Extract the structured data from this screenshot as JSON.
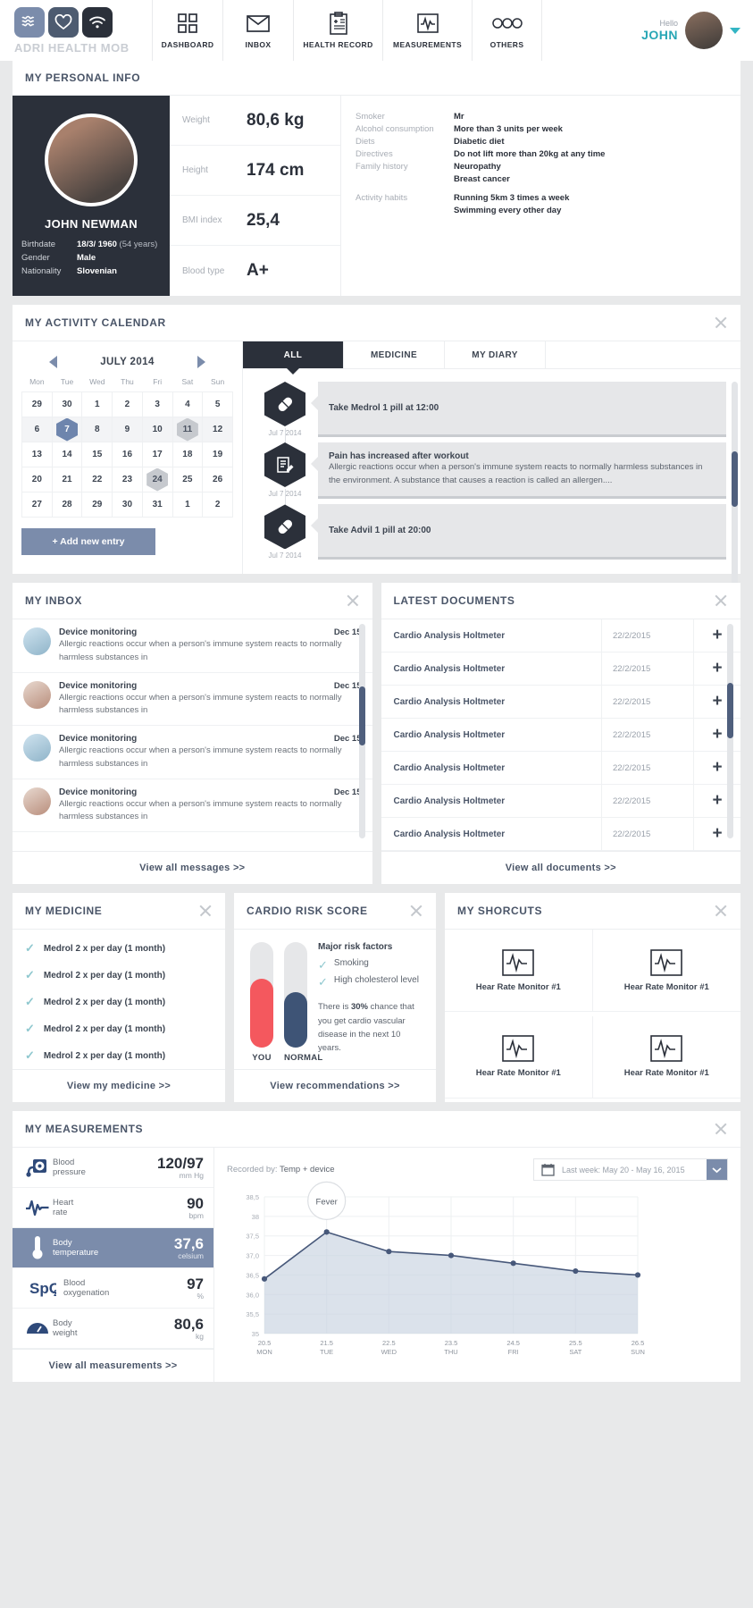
{
  "header": {
    "logo_text": "ADRI HEALTH MOB",
    "nav": [
      {
        "label": "DASHBOARD",
        "icon": "grid-icon"
      },
      {
        "label": "INBOX",
        "icon": "envelope-icon"
      },
      {
        "label": "HEALTH RECORD",
        "icon": "clipboard-icon"
      },
      {
        "label": "MEASUREMENTS",
        "icon": "pulse-icon"
      },
      {
        "label": "OTHERS",
        "icon": "dots-icon"
      }
    ],
    "hello": "Hello",
    "username": "JOHN"
  },
  "personal": {
    "title": "MY PERSONAL INFO",
    "name": "JOHN NEWMAN",
    "rows": [
      {
        "key": "Birthdate",
        "value": "18/3/ 1960",
        "extra": "(54 years)"
      },
      {
        "key": "Gender",
        "value": "Male",
        "extra": ""
      },
      {
        "key": "Nationality",
        "value": "Slovenian",
        "extra": ""
      }
    ],
    "vitals": [
      {
        "key": "Weight",
        "value": "80,6 kg"
      },
      {
        "key": "Height",
        "value": "174 cm"
      },
      {
        "key": "BMI index",
        "value": "25,4"
      },
      {
        "key": "Blood type",
        "value": "A+"
      }
    ],
    "habits": [
      {
        "key": "Smoker",
        "value": "Mr"
      },
      {
        "key": "Alcohol consumption",
        "value": "More than 3 units per week"
      },
      {
        "key": "Diets",
        "value": "Diabetic diet"
      },
      {
        "key": "Directives",
        "value": "Do not lift more than 20kg at any time"
      },
      {
        "key": "Family history",
        "value": "Neuropathy"
      },
      {
        "key": "",
        "value": "Breast cancer"
      },
      {
        "key": "Activity habits",
        "value": "Running 5km 3 times a week"
      },
      {
        "key": "",
        "value": "Swimming every other day"
      }
    ]
  },
  "calendar": {
    "title": "MY ACTIVITY CALENDAR",
    "month": "JULY 2014",
    "daynames": [
      "Mon",
      "Tue",
      "Wed",
      "Thu",
      "Fri",
      "Sat",
      "Sun"
    ],
    "weeks": [
      [
        {
          "d": "29",
          "m": true
        },
        {
          "d": "30",
          "m": true
        },
        {
          "d": "1"
        },
        {
          "d": "2"
        },
        {
          "d": "3"
        },
        {
          "d": "4"
        },
        {
          "d": "5"
        }
      ],
      [
        {
          "d": "6"
        },
        {
          "d": "7",
          "hex": "sel"
        },
        {
          "d": "8"
        },
        {
          "d": "9"
        },
        {
          "d": "10"
        },
        {
          "d": "11",
          "hex": "gray"
        },
        {
          "d": "12"
        }
      ],
      [
        {
          "d": "13"
        },
        {
          "d": "14"
        },
        {
          "d": "15"
        },
        {
          "d": "16"
        },
        {
          "d": "17"
        },
        {
          "d": "18"
        },
        {
          "d": "19"
        }
      ],
      [
        {
          "d": "20"
        },
        {
          "d": "21"
        },
        {
          "d": "22"
        },
        {
          "d": "23"
        },
        {
          "d": "24",
          "hex": "gray"
        },
        {
          "d": "25"
        },
        {
          "d": "26"
        }
      ],
      [
        {
          "d": "27"
        },
        {
          "d": "28"
        },
        {
          "d": "29"
        },
        {
          "d": "30"
        },
        {
          "d": "31"
        },
        {
          "d": "1",
          "m": true
        },
        {
          "d": "2",
          "m": true
        }
      ]
    ],
    "shaded_week": 1,
    "add_entry": "+ Add new entry",
    "tabs": [
      {
        "label": "ALL",
        "active": true
      },
      {
        "label": "MEDICINE",
        "active": false
      },
      {
        "label": "MY DIARY",
        "active": false
      }
    ],
    "timeline": [
      {
        "icon": "pill-icon",
        "date": "Jul 7 2014",
        "title": "Take Medrol 1 pill at 12:00",
        "text": ""
      },
      {
        "icon": "diary-icon",
        "date": "Jul 7 2014",
        "title": "Pain has increased after workout",
        "text": "Allergic reactions occur when a person's immune system reacts to normally harmless substances in the environment. A substance that causes a reaction is called an allergen...."
      },
      {
        "icon": "pill-icon",
        "date": "Jul 7 2014",
        "title": "Take Advil 1 pill at 20:00",
        "text": ""
      }
    ]
  },
  "inbox": {
    "title": "MY INBOX",
    "messages": [
      {
        "from": "Device monitoring",
        "date": "Dec 15",
        "avatar": "avatar-male",
        "body": "Allergic reactions occur when a person's immune system reacts to normally harmless substances in"
      },
      {
        "from": "Device monitoring",
        "date": "Dec 15",
        "avatar": "avatar-female",
        "body": "Allergic reactions occur when a person's immune system reacts to normally harmless substances in"
      },
      {
        "from": "Device monitoring",
        "date": "Dec 15",
        "avatar": "avatar-male",
        "body": "Allergic reactions occur when a person's immune system reacts to normally harmless substances in"
      },
      {
        "from": "Device monitoring",
        "date": "Dec 15",
        "avatar": "avatar-female",
        "body": "Allergic reactions occur when a person's immune system reacts to normally harmless substances in"
      }
    ],
    "view_all": "View all messages >>"
  },
  "documents": {
    "title": "LATEST DOCUMENTS",
    "rows": [
      {
        "name": "Cardio Analysis Holtmeter",
        "date": "22/2/2015"
      },
      {
        "name": "Cardio Analysis Holtmeter",
        "date": "22/2/2015"
      },
      {
        "name": "Cardio Analysis Holtmeter",
        "date": "22/2/2015"
      },
      {
        "name": "Cardio Analysis Holtmeter",
        "date": "22/2/2015"
      },
      {
        "name": "Cardio Analysis Holtmeter",
        "date": "22/2/2015"
      },
      {
        "name": "Cardio Analysis Holtmeter",
        "date": "22/2/2015"
      },
      {
        "name": "Cardio Analysis Holtmeter",
        "date": "22/2/2015"
      }
    ],
    "add_icon": "plus-icon",
    "view_all": "View all documents >>"
  },
  "medicine": {
    "title": "MY MEDICINE",
    "items": [
      "Medrol 2 x per day (1 month)",
      "Medrol 2 x per day (1 month)",
      "Medrol 2 x per day (1 month)",
      "Medrol 2 x per day (1 month)",
      "Medrol 2 x per day (1 month)"
    ],
    "view_all": "View my medicine >>"
  },
  "cardio": {
    "title": "CARDIO RISK SCORE",
    "bars": [
      {
        "label": "YOU",
        "pct": 66,
        "color": "#f4585e"
      },
      {
        "label": "NORMAL",
        "pct": 53,
        "color": "#3e5476"
      }
    ],
    "risk_heading": "Major risk factors",
    "risk_factors": [
      "Smoking",
      "High cholesterol level"
    ],
    "summary_pre": "There is ",
    "summary_pct": "30%",
    "summary_post": " chance that you get cardio vascular disease in the next 10 years.",
    "view_all": "View recommendations >>"
  },
  "shortcuts": {
    "title": "MY SHORCUTS",
    "items": [
      {
        "label": "Hear Rate Monitor #1",
        "icon": "heart-rate-monitor-icon"
      },
      {
        "label": "Hear Rate Monitor #1",
        "icon": "heart-rate-monitor-icon"
      },
      {
        "label": "Hear Rate Monitor #1",
        "icon": "heart-rate-monitor-icon"
      },
      {
        "label": "Hear Rate Monitor #1",
        "icon": "heart-rate-monitor-icon"
      }
    ]
  },
  "measurements": {
    "title": "MY MEASUREMENTS",
    "rows": [
      {
        "name": "Blood\npressure",
        "name1": "Blood",
        "name2": "pressure",
        "value": "120/97",
        "unit": "mm Hg",
        "icon": "blood-pressure-icon",
        "active": false
      },
      {
        "name1": "Heart",
        "name2": "rate",
        "value": "90",
        "unit": "bpm",
        "icon": "heart-rate-icon",
        "active": false
      },
      {
        "name1": "Body",
        "name2": "temperature",
        "value": "37,6",
        "unit": "celsium",
        "icon": "thermometer-icon",
        "active": true
      },
      {
        "name1": "Blood",
        "name2": "oxygenation",
        "value": "97",
        "unit": "%",
        "icon": "spo2-icon",
        "active": false,
        "prefix": "SpO₂"
      },
      {
        "name1": "Body",
        "name2": "weight",
        "value": "80,6",
        "unit": "kg",
        "icon": "scale-icon",
        "active": false
      }
    ],
    "recorded_label": "Recorded by:",
    "recorded_value": "Temp + device",
    "date_range": "Last week: May 20 - May 16, 2015",
    "calendar_icon": "calendar-icon",
    "caret_icon": "chevron-down-icon",
    "view_all": "View all measurements >>"
  },
  "chart_data": {
    "type": "area",
    "title": "Body temperature",
    "xlabel": "",
    "ylabel": "celsium",
    "categories": [
      "20.5",
      "21.5",
      "22.5",
      "23.5",
      "24.5",
      "25.5",
      "26.5"
    ],
    "day_labels": [
      "MON",
      "TUE",
      "WED",
      "THU",
      "FRI",
      "SAT",
      "SUN"
    ],
    "values": [
      36.4,
      37.6,
      37.1,
      37.0,
      36.8,
      36.6,
      36.5
    ],
    "ytick_labels": [
      "38,5",
      "38",
      "37,5",
      "37,0",
      "36,5",
      "36,0",
      "35,5",
      "35"
    ],
    "ytick_values": [
      38.5,
      38.0,
      37.5,
      37.0,
      36.5,
      36.0,
      35.5,
      35.0
    ],
    "ylim": [
      35.0,
      38.5
    ],
    "grid": true,
    "annotation": "Fever",
    "annotation_at_index": 1,
    "legend": "none",
    "line_color": "#47587a",
    "fill_color": "#c8d2e0"
  }
}
